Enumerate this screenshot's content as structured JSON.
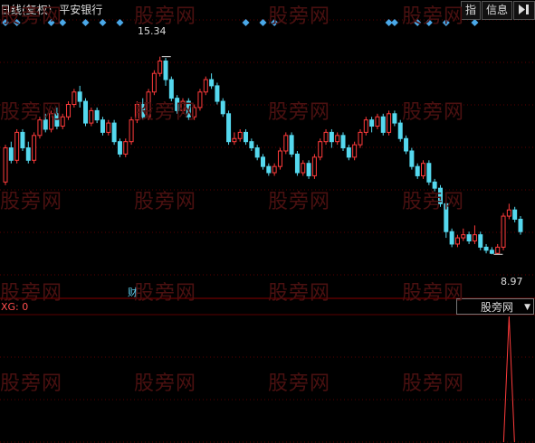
{
  "header": {
    "period": "日线(复权)",
    "stock_name": "平安银行",
    "btn_index": "指",
    "btn_info": "信息",
    "btn_exit_icon": "exit-icon"
  },
  "sub_panel": {
    "label": "XG: 0",
    "dropdown_value": "股旁网"
  },
  "annotations": {
    "high_label": "15.34",
    "low_label": "8.97",
    "cai_label": "财"
  },
  "watermark": "股旁网",
  "colors": {
    "up": "#ff3b3b",
    "down": "#55d8ee",
    "grid": "#5a0000",
    "signal": "#ff3b3b",
    "diamond": "#4aa8e8"
  },
  "chart_data": {
    "type": "candlestick",
    "ylim": [
      7.9,
      16.0
    ],
    "high": 15.34,
    "low": 8.97,
    "candles": [
      [
        11.3,
        12.4,
        12.5,
        11.2
      ],
      [
        12.4,
        12.0,
        12.6,
        11.9
      ],
      [
        12.0,
        12.9,
        13.0,
        11.9
      ],
      [
        12.9,
        12.4,
        13.0,
        12.3
      ],
      [
        12.4,
        12.0,
        12.6,
        11.9
      ],
      [
        12.0,
        12.8,
        12.9,
        11.9
      ],
      [
        12.8,
        13.3,
        13.4,
        12.7
      ],
      [
        13.3,
        13.0,
        13.5,
        12.9
      ],
      [
        13.0,
        13.5,
        13.6,
        12.9
      ],
      [
        13.5,
        13.1,
        13.7,
        13.0
      ],
      [
        13.1,
        13.4,
        13.5,
        13.0
      ],
      [
        13.4,
        13.8,
        13.9,
        13.3
      ],
      [
        13.8,
        14.2,
        14.3,
        13.7
      ],
      [
        14.2,
        13.9,
        14.4,
        13.7
      ],
      [
        13.9,
        13.2,
        14.0,
        13.1
      ],
      [
        13.2,
        13.6,
        13.7,
        13.1
      ],
      [
        13.6,
        13.3,
        13.7,
        13.2
      ],
      [
        13.3,
        12.9,
        13.4,
        12.8
      ],
      [
        12.9,
        13.2,
        13.3,
        12.8
      ],
      [
        13.2,
        12.6,
        13.3,
        12.5
      ],
      [
        12.6,
        12.2,
        12.7,
        12.1
      ],
      [
        12.2,
        12.6,
        12.7,
        12.1
      ],
      [
        12.6,
        13.3,
        13.4,
        12.5
      ],
      [
        13.3,
        13.8,
        13.9,
        13.2
      ],
      [
        13.8,
        13.4,
        14.0,
        13.3
      ],
      [
        13.4,
        14.2,
        14.3,
        13.3
      ],
      [
        14.2,
        14.8,
        14.9,
        14.1
      ],
      [
        14.8,
        15.2,
        15.34,
        14.7
      ],
      [
        15.2,
        14.6,
        15.3,
        14.4
      ],
      [
        14.6,
        14.0,
        14.7,
        13.9
      ],
      [
        14.0,
        13.6,
        14.1,
        13.5
      ],
      [
        13.6,
        13.9,
        14.0,
        13.5
      ],
      [
        13.9,
        13.4,
        14.0,
        13.3
      ],
      [
        13.4,
        13.7,
        13.8,
        13.3
      ],
      [
        13.7,
        14.2,
        14.3,
        13.6
      ],
      [
        14.2,
        14.6,
        14.7,
        14.1
      ],
      [
        14.6,
        14.4,
        14.8,
        14.3
      ],
      [
        14.4,
        13.9,
        14.5,
        13.8
      ],
      [
        13.9,
        13.5,
        14.0,
        13.4
      ],
      [
        13.5,
        12.6,
        13.6,
        12.5
      ],
      [
        12.6,
        12.7,
        12.9,
        12.5
      ],
      [
        12.7,
        12.9,
        13.0,
        12.6
      ],
      [
        12.9,
        12.6,
        13.0,
        12.5
      ],
      [
        12.6,
        12.4,
        12.7,
        12.3
      ],
      [
        12.4,
        12.1,
        12.5,
        12.0
      ],
      [
        12.1,
        11.8,
        12.2,
        11.7
      ],
      [
        11.8,
        11.6,
        11.9,
        11.5
      ],
      [
        11.6,
        11.8,
        11.9,
        11.5
      ],
      [
        11.8,
        12.3,
        12.4,
        11.7
      ],
      [
        12.3,
        12.8,
        12.9,
        12.2
      ],
      [
        12.8,
        12.2,
        12.9,
        12.1
      ],
      [
        12.2,
        11.6,
        12.3,
        11.5
      ],
      [
        11.6,
        11.9,
        12.0,
        11.5
      ],
      [
        11.9,
        11.5,
        12.0,
        11.4
      ],
      [
        11.5,
        12.1,
        12.2,
        11.4
      ],
      [
        12.1,
        12.6,
        12.7,
        12.0
      ],
      [
        12.6,
        12.9,
        13.0,
        12.5
      ],
      [
        12.9,
        12.6,
        13.0,
        12.4
      ],
      [
        12.6,
        12.8,
        12.9,
        12.5
      ],
      [
        12.8,
        12.4,
        12.9,
        12.3
      ],
      [
        12.4,
        12.1,
        12.5,
        12.0
      ],
      [
        12.1,
        12.5,
        12.6,
        12.0
      ],
      [
        12.5,
        12.9,
        13.0,
        12.4
      ],
      [
        12.9,
        13.3,
        13.4,
        12.8
      ],
      [
        13.3,
        13.1,
        13.4,
        12.9
      ],
      [
        13.1,
        13.4,
        13.5,
        13.0
      ],
      [
        13.4,
        12.9,
        13.5,
        12.8
      ],
      [
        12.9,
        13.5,
        13.6,
        12.8
      ],
      [
        13.5,
        13.2,
        13.6,
        13.1
      ],
      [
        13.2,
        12.7,
        13.3,
        12.6
      ],
      [
        12.7,
        12.3,
        12.8,
        12.2
      ],
      [
        12.3,
        11.8,
        12.4,
        11.7
      ],
      [
        11.8,
        11.5,
        11.9,
        11.4
      ],
      [
        11.5,
        11.9,
        12.0,
        11.4
      ],
      [
        11.9,
        11.3,
        12.0,
        11.2
      ],
      [
        11.3,
        11.1,
        11.4,
        11.0
      ],
      [
        11.1,
        10.6,
        11.2,
        10.5
      ],
      [
        10.6,
        9.7,
        10.7,
        9.5
      ],
      [
        9.7,
        9.3,
        9.8,
        9.2
      ],
      [
        9.3,
        9.5,
        9.6,
        9.2
      ],
      [
        9.5,
        9.6,
        9.8,
        9.4
      ],
      [
        9.6,
        9.4,
        9.7,
        9.3
      ],
      [
        9.4,
        9.6,
        9.9,
        9.3
      ],
      [
        9.6,
        9.2,
        9.7,
        9.1
      ],
      [
        9.2,
        9.1,
        9.3,
        9.0
      ],
      [
        9.1,
        9.0,
        9.2,
        8.97
      ],
      [
        9.0,
        9.2,
        9.3,
        8.97
      ],
      [
        9.2,
        10.2,
        10.3,
        9.1
      ],
      [
        10.2,
        10.4,
        10.6,
        10.1
      ],
      [
        10.4,
        10.1,
        10.5,
        10.0
      ],
      [
        10.1,
        9.7,
        10.2,
        9.6
      ]
    ],
    "top_signals": [
      0,
      2,
      8,
      10,
      14,
      17,
      20,
      42,
      45,
      47,
      67,
      68,
      72,
      74,
      77,
      82
    ],
    "bottom_signal_index": 88
  }
}
